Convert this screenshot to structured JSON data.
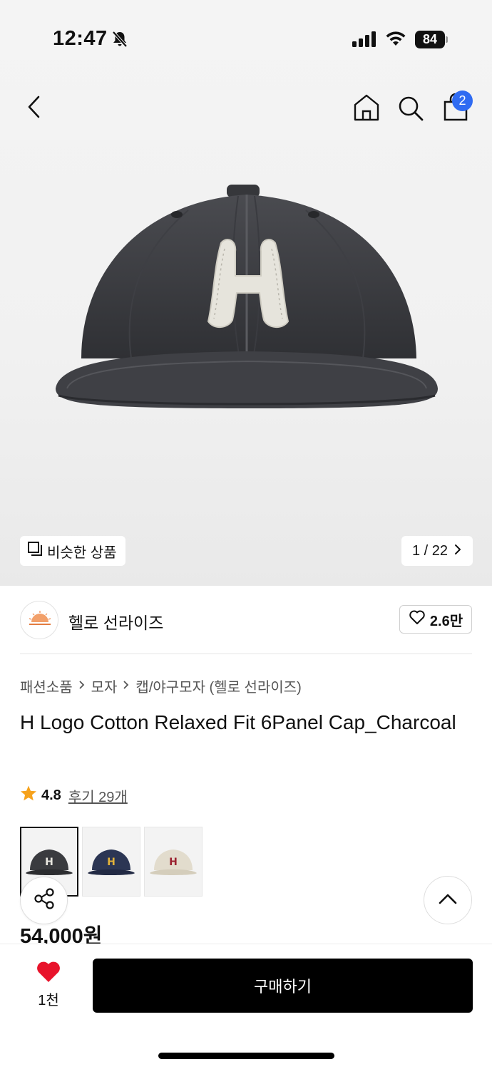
{
  "status_bar": {
    "time": "12:47",
    "battery": "84",
    "icons": [
      "bell-off-icon",
      "signal-icon",
      "wifi-icon",
      "battery-icon"
    ]
  },
  "nav": {
    "icons": [
      "back-icon",
      "home-icon",
      "search-icon",
      "shopping-bag-icon"
    ],
    "cart_count": "2"
  },
  "gallery": {
    "similar_label": "비슷한 상품",
    "pager": "1 / 22"
  },
  "brand": {
    "name": "헬로 선라이즈",
    "likes": "2.6만"
  },
  "breadcrumb": [
    "패션소품",
    "모자",
    "캡/야구모자 (헬로 선라이즈)"
  ],
  "product": {
    "title": "H Logo Cotton Relaxed Fit 6Panel Cap_Charcoal",
    "rating": "4.8",
    "review_text": "후기 29개",
    "price": "54,000원",
    "variants": [
      {
        "color": "#3a3b3f",
        "logo_color": "#e8e6df",
        "selected": true
      },
      {
        "color": "#2c3654",
        "logo_color": "#e2b23a",
        "selected": false
      },
      {
        "color": "#e2dccd",
        "logo_color": "#9b2230",
        "selected": false
      }
    ]
  },
  "bottom": {
    "like_count": "1천",
    "buy_label": "구매하기"
  },
  "colors": {
    "accent_badge": "#2f6bf2",
    "heart": "#e8132b",
    "star": "#f6a21c",
    "buy_button": "#000000"
  }
}
